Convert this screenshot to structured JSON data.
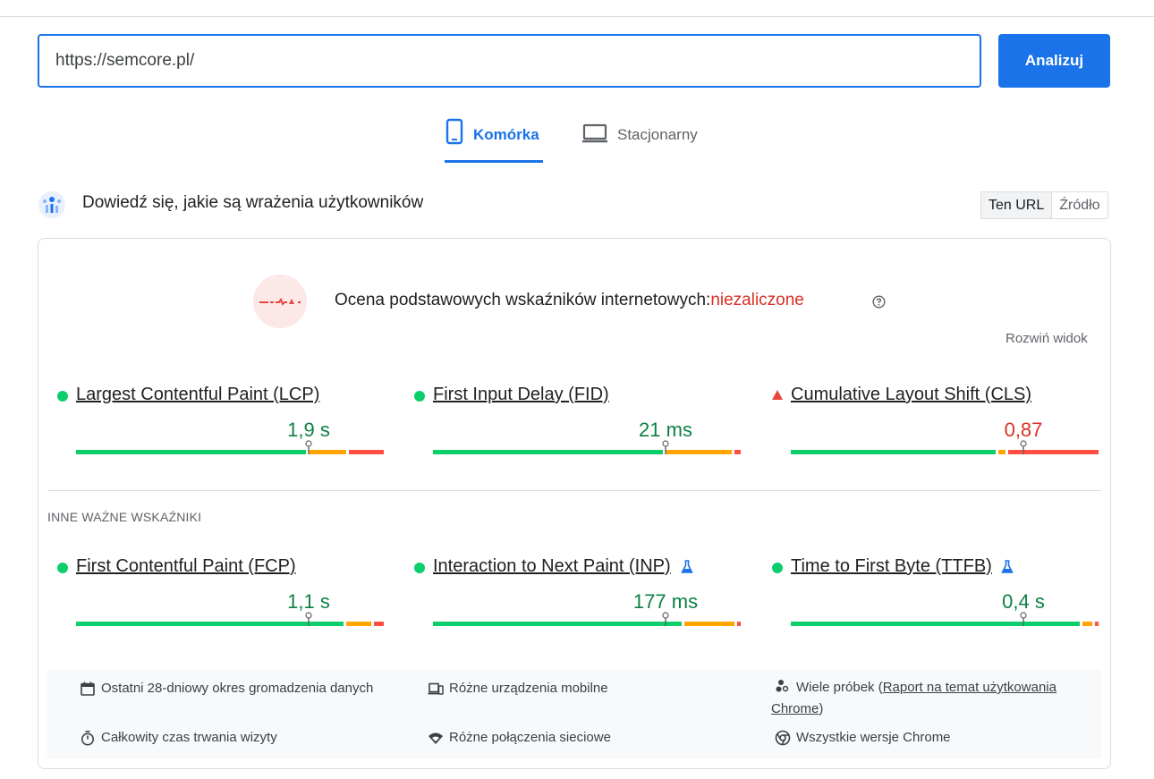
{
  "search": {
    "url_value": "https://semcore.pl/",
    "analyze_label": "Analizuj"
  },
  "tabs": [
    {
      "label": "Komórka"
    },
    {
      "label": "Stacjonarny"
    }
  ],
  "section": {
    "title": "Dowiedź się, jakie są wrażenia użytkowników",
    "toggle": [
      "Ten URL",
      "Źródło"
    ]
  },
  "assessment": {
    "text": "Ocena podstawowych wskaźników internetowych:",
    "status": "niezaliczone",
    "expand_label": "Rozwiń widok"
  },
  "core_metrics": [
    {
      "name": "Largest Contentful Paint (LCP)",
      "value": "1,9 s",
      "status": "good",
      "distribution": [
        0.75,
        0.13,
        0.12
      ],
      "marker": 0.75
    },
    {
      "name": "First Input Delay (FID)",
      "value": "21 ms",
      "status": "good",
      "distribution": [
        0.75,
        0.22,
        0.03
      ],
      "marker": 0.75
    },
    {
      "name": "Cumulative Layout Shift (CLS)",
      "value": "0,87",
      "status": "poor",
      "distribution": [
        0.67,
        0.03,
        0.3
      ],
      "marker": 0.75
    }
  ],
  "other_title": "INNE WAŻNE WSKAŹNIKI",
  "other_metrics": [
    {
      "name": "First Contentful Paint (FCP)",
      "value": "1,1 s",
      "status": "good",
      "experimental": false,
      "distribution": [
        0.87,
        0.09,
        0.04
      ],
      "marker": 0.75
    },
    {
      "name": "Interaction to Next Paint (INP)",
      "value": "177 ms",
      "status": "good",
      "experimental": true,
      "distribution": [
        0.81,
        0.17,
        0.02
      ],
      "marker": 0.75
    },
    {
      "name": "Time to First Byte (TTFB)",
      "value": "0,4 s",
      "status": "good",
      "experimental": true,
      "distribution": [
        0.94,
        0.04,
        0.02
      ],
      "marker": 0.75
    }
  ],
  "info": {
    "period": "Ostatni 28-dniowy okres gromadzenia danych",
    "devices": "Różne urządzenia mobilne",
    "samples_prefix": "Wiele próbek (",
    "samples_link": "Raport na temat użytkowania Chrome",
    "samples_suffix": ")",
    "duration": "Całkowity czas trwania wizyty",
    "network": "Różne połączenia sieciowe",
    "versions": "Wszystkie wersje Chrome"
  },
  "colors": {
    "accent": "#1a73e8",
    "good": "#0cce6b",
    "average": "#ffa400",
    "poor": "#ff4e42"
  }
}
